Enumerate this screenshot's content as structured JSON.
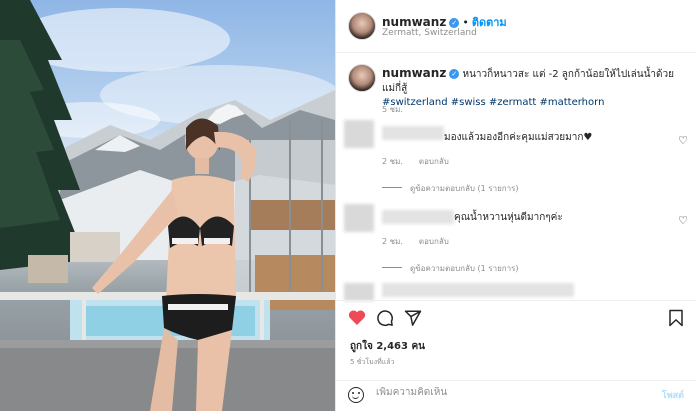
{
  "post": {
    "username": "numwanz",
    "verified_glyph": "✓",
    "separator": "•",
    "follow_label": "ติดตาม",
    "location": "Zermatt, Switzerland",
    "more_glyph": "···"
  },
  "caption": {
    "username": "numwanz",
    "text": "หนาวก็หนาวสะ แต่ -2 ลูกก้าน้อยให้ไปเล่นน้ำด้วยแม่กี่สู้",
    "hashtags": "#switzerland #swiss #zermatt #matterhorn",
    "time": "5 ชม."
  },
  "comments": [
    {
      "text": "มองแล้วมองอีกค่ะคุมแม่สวยมาก♥",
      "time": "2 ชม.",
      "reply_label": "ตอบกลับ",
      "view_replies": "ดูข้อความตอบกลับ (1 รายการ)"
    },
    {
      "text": "คุณน้ำหวานหุ่นดีมากๆค่ะ",
      "time": "2 ชม.",
      "reply_label": "ตอบกลับ",
      "view_replies": "ดูข้อความตอบกลับ (1 รายการ)"
    }
  ],
  "engagement": {
    "likes": "ถูกใจ 2,463 คน",
    "time_ago": "5 ชั่วโมงที่แล้ว"
  },
  "composer": {
    "placeholder": "เพิ่มความคิดเห็น",
    "post_label": "โพสต์"
  },
  "icons": {
    "like": "heart-icon",
    "comment": "comment-icon",
    "share": "share-icon",
    "save": "bookmark-icon",
    "emoji": "emoji-icon",
    "comment_like": "heart-outline-icon"
  },
  "colors": {
    "heart_active": "#ed4956",
    "follow": "#0095f6",
    "hashtag": "#00376b",
    "verified": "#3897f0",
    "muted": "#8e8e8e"
  }
}
